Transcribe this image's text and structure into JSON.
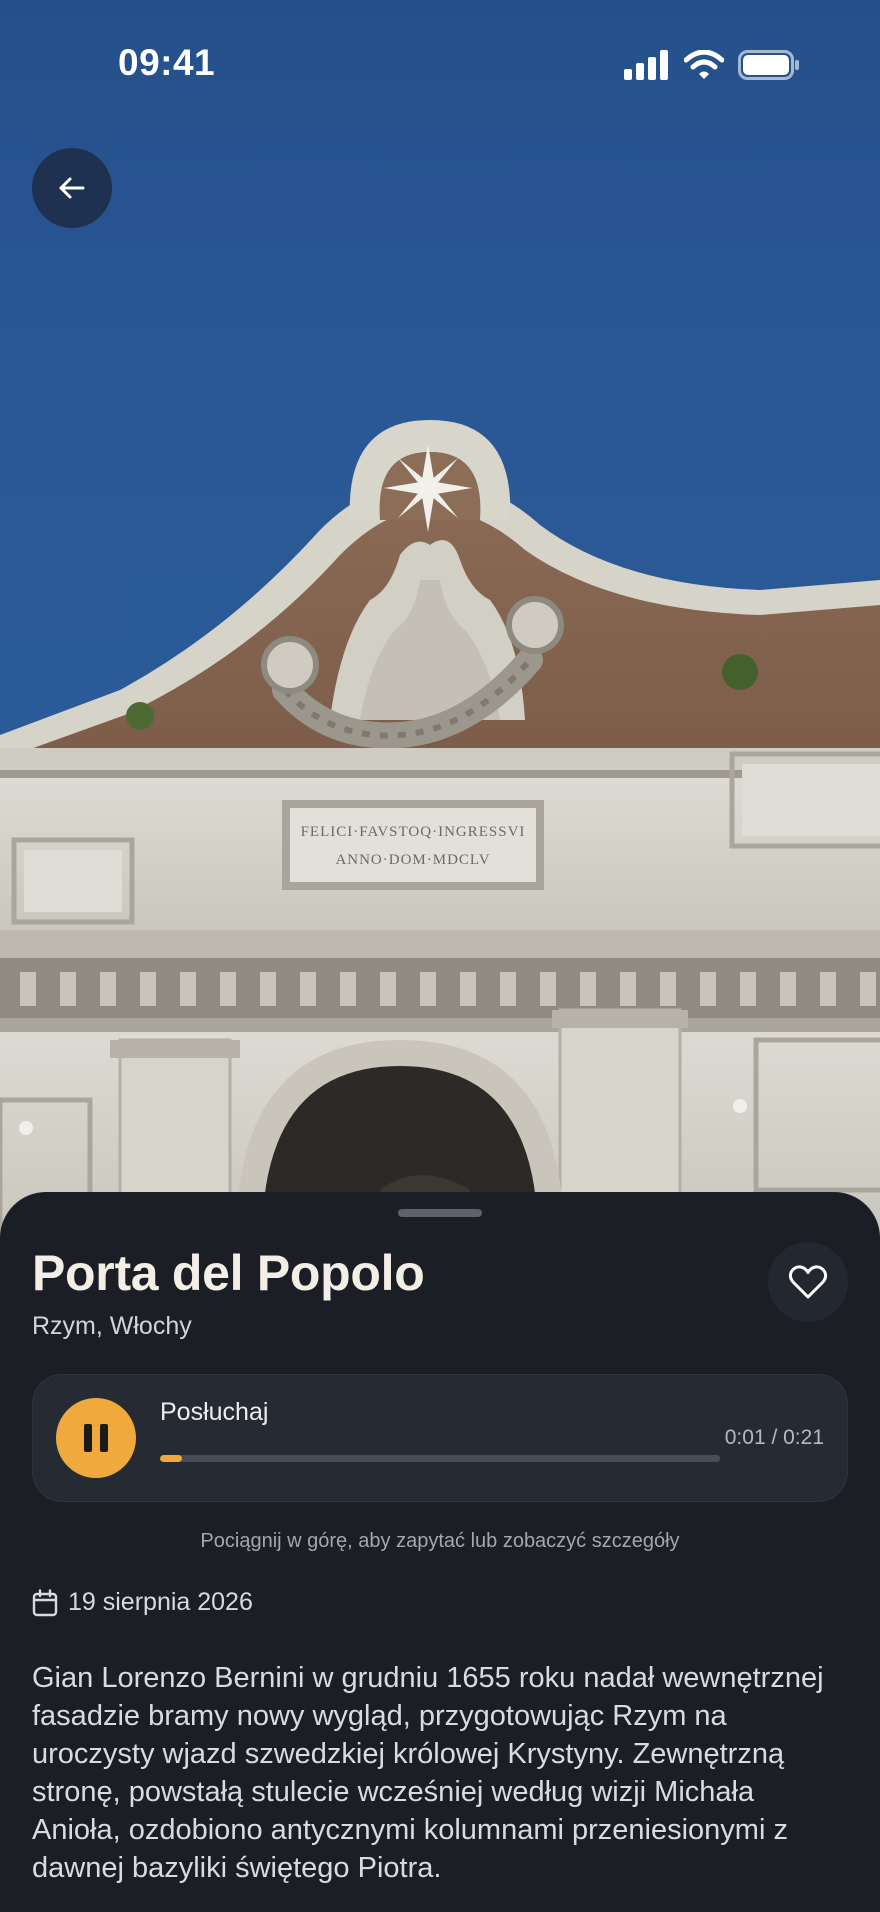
{
  "status_bar": {
    "time": "09:41",
    "icons": [
      "cellular-signal-icon",
      "wifi-icon",
      "battery-icon"
    ]
  },
  "photo": {
    "inscription_line1": "FELICI·FAVSTOQ·INGRESSVI",
    "inscription_line2": "ANNO·DOM·MDCLV"
  },
  "navigation": {
    "back_icon": "arrow-left-icon"
  },
  "place": {
    "title": "Porta del Popolo",
    "subtitle": "Rzym, Włochy",
    "favorite_icon": "heart-outline-icon"
  },
  "audio": {
    "label": "Posłuchaj",
    "time": "0:01 / 0:21",
    "progress": 0.04,
    "state_icon": "pause-icon"
  },
  "hint": "Pociągnij w górę, aby zapytać lub zobaczyć szczegóły",
  "date": {
    "icon": "calendar-icon",
    "text": "19 sierpnia 2026"
  },
  "description": "Gian Lorenzo Bernini w grudniu 1655 roku nadał wewnętrznej fasadzie bramy nowy wygląd, przygotowując Rzym na uroczysty wjazd szwedzkiej królowej Krystyny. Zewnętrzną stronę, powstałą stulecie wcześniej według wizji Michała Anioła, ozdobiono antycznymi kolumnami przeniesionymi z dawnej bazyliki świętego Piotra.",
  "colors": {
    "accent": "#f0a93c",
    "sheet_background": "#1b1e25",
    "sky": "#2a5896"
  }
}
